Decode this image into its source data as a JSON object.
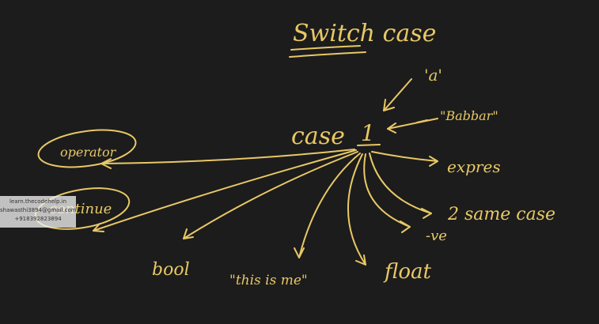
{
  "title": "Switch case",
  "center_label": "case",
  "center_value": "1",
  "labels": {
    "a": "'a'",
    "string": "\"Babbar\"",
    "expression": "expres",
    "operator": "operator",
    "continue": "continue",
    "bool": "bool",
    "this_is_me": "\"this is me\"",
    "float": "float",
    "same_case": "2 same case",
    "negative": "-ve"
  },
  "watermark": {
    "line1": "learn.thecodehelp.in",
    "line2": "shawasthi3894@gmail.com",
    "line3": "+918392823894"
  },
  "colors": {
    "background": "#1c1c1c",
    "ink": "#e8c866"
  }
}
